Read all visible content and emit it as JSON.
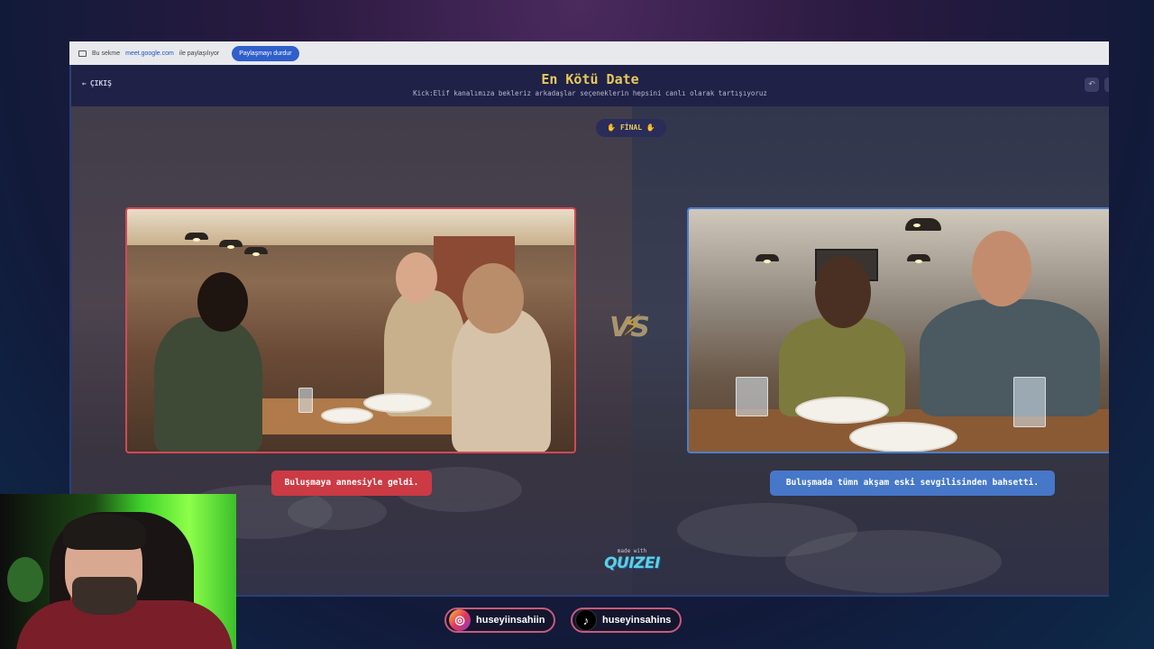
{
  "share_bar": {
    "text_before": "Bu sekme",
    "domain": "meet.google.com",
    "text_after": "ile paylaşılıyor",
    "stop_button": "Paylaşmayı durdur"
  },
  "header": {
    "back_label": "ÇIKIŞ",
    "title": "En Kötü Date",
    "subtitle": "Kick:Elif kanalımıza bekleriz arkadaşlar seçeneklerin hepsini canlı olarak tartışıyoruz"
  },
  "stage": {
    "round_badge": "✋ FİNAL ✋",
    "vs_label": "VS",
    "left_option": {
      "caption": "Buluşmaya annesiyle geldi.",
      "accent": "#cc3a44"
    },
    "right_option": {
      "caption": "Buluşmada tümn akşam eski sevgilisinden bahsetti.",
      "accent": "#4677c8"
    },
    "made_with_small": "made with",
    "made_with_brand": "QUIZEI"
  },
  "socials": {
    "instagram": "huseyiinsahiin",
    "tiktok": "huseyinsahins"
  },
  "colors": {
    "title": "#e7c95a",
    "panel_bg": "#23244a",
    "share_button": "#2f5fc9"
  },
  "icons": [
    "screen-share-icon",
    "back-arrow-icon",
    "undo-icon",
    "lightning-bolt-icon",
    "instagram-icon",
    "tiktok-icon"
  ]
}
